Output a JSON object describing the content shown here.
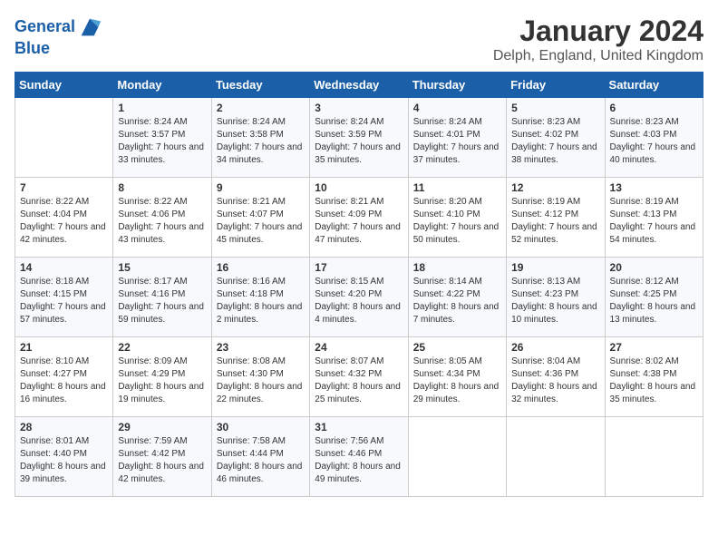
{
  "logo": {
    "line1": "General",
    "line2": "Blue"
  },
  "title": "January 2024",
  "subtitle": "Delph, England, United Kingdom",
  "days_header": [
    "Sunday",
    "Monday",
    "Tuesday",
    "Wednesday",
    "Thursday",
    "Friday",
    "Saturday"
  ],
  "weeks": [
    [
      {
        "day": "",
        "sunrise": "",
        "sunset": "",
        "daylight": ""
      },
      {
        "day": "1",
        "sunrise": "Sunrise: 8:24 AM",
        "sunset": "Sunset: 3:57 PM",
        "daylight": "Daylight: 7 hours and 33 minutes."
      },
      {
        "day": "2",
        "sunrise": "Sunrise: 8:24 AM",
        "sunset": "Sunset: 3:58 PM",
        "daylight": "Daylight: 7 hours and 34 minutes."
      },
      {
        "day": "3",
        "sunrise": "Sunrise: 8:24 AM",
        "sunset": "Sunset: 3:59 PM",
        "daylight": "Daylight: 7 hours and 35 minutes."
      },
      {
        "day": "4",
        "sunrise": "Sunrise: 8:24 AM",
        "sunset": "Sunset: 4:01 PM",
        "daylight": "Daylight: 7 hours and 37 minutes."
      },
      {
        "day": "5",
        "sunrise": "Sunrise: 8:23 AM",
        "sunset": "Sunset: 4:02 PM",
        "daylight": "Daylight: 7 hours and 38 minutes."
      },
      {
        "day": "6",
        "sunrise": "Sunrise: 8:23 AM",
        "sunset": "Sunset: 4:03 PM",
        "daylight": "Daylight: 7 hours and 40 minutes."
      }
    ],
    [
      {
        "day": "7",
        "sunrise": "Sunrise: 8:22 AM",
        "sunset": "Sunset: 4:04 PM",
        "daylight": "Daylight: 7 hours and 42 minutes."
      },
      {
        "day": "8",
        "sunrise": "Sunrise: 8:22 AM",
        "sunset": "Sunset: 4:06 PM",
        "daylight": "Daylight: 7 hours and 43 minutes."
      },
      {
        "day": "9",
        "sunrise": "Sunrise: 8:21 AM",
        "sunset": "Sunset: 4:07 PM",
        "daylight": "Daylight: 7 hours and 45 minutes."
      },
      {
        "day": "10",
        "sunrise": "Sunrise: 8:21 AM",
        "sunset": "Sunset: 4:09 PM",
        "daylight": "Daylight: 7 hours and 47 minutes."
      },
      {
        "day": "11",
        "sunrise": "Sunrise: 8:20 AM",
        "sunset": "Sunset: 4:10 PM",
        "daylight": "Daylight: 7 hours and 50 minutes."
      },
      {
        "day": "12",
        "sunrise": "Sunrise: 8:19 AM",
        "sunset": "Sunset: 4:12 PM",
        "daylight": "Daylight: 7 hours and 52 minutes."
      },
      {
        "day": "13",
        "sunrise": "Sunrise: 8:19 AM",
        "sunset": "Sunset: 4:13 PM",
        "daylight": "Daylight: 7 hours and 54 minutes."
      }
    ],
    [
      {
        "day": "14",
        "sunrise": "Sunrise: 8:18 AM",
        "sunset": "Sunset: 4:15 PM",
        "daylight": "Daylight: 7 hours and 57 minutes."
      },
      {
        "day": "15",
        "sunrise": "Sunrise: 8:17 AM",
        "sunset": "Sunset: 4:16 PM",
        "daylight": "Daylight: 7 hours and 59 minutes."
      },
      {
        "day": "16",
        "sunrise": "Sunrise: 8:16 AM",
        "sunset": "Sunset: 4:18 PM",
        "daylight": "Daylight: 8 hours and 2 minutes."
      },
      {
        "day": "17",
        "sunrise": "Sunrise: 8:15 AM",
        "sunset": "Sunset: 4:20 PM",
        "daylight": "Daylight: 8 hours and 4 minutes."
      },
      {
        "day": "18",
        "sunrise": "Sunrise: 8:14 AM",
        "sunset": "Sunset: 4:22 PM",
        "daylight": "Daylight: 8 hours and 7 minutes."
      },
      {
        "day": "19",
        "sunrise": "Sunrise: 8:13 AM",
        "sunset": "Sunset: 4:23 PM",
        "daylight": "Daylight: 8 hours and 10 minutes."
      },
      {
        "day": "20",
        "sunrise": "Sunrise: 8:12 AM",
        "sunset": "Sunset: 4:25 PM",
        "daylight": "Daylight: 8 hours and 13 minutes."
      }
    ],
    [
      {
        "day": "21",
        "sunrise": "Sunrise: 8:10 AM",
        "sunset": "Sunset: 4:27 PM",
        "daylight": "Daylight: 8 hours and 16 minutes."
      },
      {
        "day": "22",
        "sunrise": "Sunrise: 8:09 AM",
        "sunset": "Sunset: 4:29 PM",
        "daylight": "Daylight: 8 hours and 19 minutes."
      },
      {
        "day": "23",
        "sunrise": "Sunrise: 8:08 AM",
        "sunset": "Sunset: 4:30 PM",
        "daylight": "Daylight: 8 hours and 22 minutes."
      },
      {
        "day": "24",
        "sunrise": "Sunrise: 8:07 AM",
        "sunset": "Sunset: 4:32 PM",
        "daylight": "Daylight: 8 hours and 25 minutes."
      },
      {
        "day": "25",
        "sunrise": "Sunrise: 8:05 AM",
        "sunset": "Sunset: 4:34 PM",
        "daylight": "Daylight: 8 hours and 29 minutes."
      },
      {
        "day": "26",
        "sunrise": "Sunrise: 8:04 AM",
        "sunset": "Sunset: 4:36 PM",
        "daylight": "Daylight: 8 hours and 32 minutes."
      },
      {
        "day": "27",
        "sunrise": "Sunrise: 8:02 AM",
        "sunset": "Sunset: 4:38 PM",
        "daylight": "Daylight: 8 hours and 35 minutes."
      }
    ],
    [
      {
        "day": "28",
        "sunrise": "Sunrise: 8:01 AM",
        "sunset": "Sunset: 4:40 PM",
        "daylight": "Daylight: 8 hours and 39 minutes."
      },
      {
        "day": "29",
        "sunrise": "Sunrise: 7:59 AM",
        "sunset": "Sunset: 4:42 PM",
        "daylight": "Daylight: 8 hours and 42 minutes."
      },
      {
        "day": "30",
        "sunrise": "Sunrise: 7:58 AM",
        "sunset": "Sunset: 4:44 PM",
        "daylight": "Daylight: 8 hours and 46 minutes."
      },
      {
        "day": "31",
        "sunrise": "Sunrise: 7:56 AM",
        "sunset": "Sunset: 4:46 PM",
        "daylight": "Daylight: 8 hours and 49 minutes."
      },
      {
        "day": "",
        "sunrise": "",
        "sunset": "",
        "daylight": ""
      },
      {
        "day": "",
        "sunrise": "",
        "sunset": "",
        "daylight": ""
      },
      {
        "day": "",
        "sunrise": "",
        "sunset": "",
        "daylight": ""
      }
    ]
  ]
}
